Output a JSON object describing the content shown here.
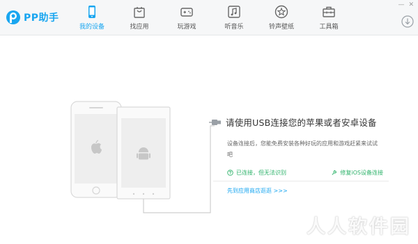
{
  "app": {
    "name": "PP助手",
    "brand_color": "#19a6f0",
    "accent_green": "#2fb36b"
  },
  "nav": {
    "items": [
      {
        "label": "我的设备",
        "icon": "phone-icon",
        "active": true
      },
      {
        "label": "找应用",
        "icon": "shopping-bag-icon",
        "active": false
      },
      {
        "label": "玩游戏",
        "icon": "gamepad-icon",
        "active": false
      },
      {
        "label": "听音乐",
        "icon": "music-icon",
        "active": false
      },
      {
        "label": "铃声壁纸",
        "icon": "star-icon",
        "active": false
      },
      {
        "label": "工具箱",
        "icon": "toolbox-icon",
        "active": false
      }
    ]
  },
  "window_controls": {
    "minimize": "—",
    "close": "✕"
  },
  "main": {
    "headline": "请使用USB连接您的苹果或者安卓设备",
    "description": "设备连接后，您能免费安装各种好玩的应用和游戏赶紧来试试吧",
    "link_recognize": "已连接，但无法识别",
    "link_repair": "修复iOS设备连接",
    "skip_link": "先到应用商店逛逛 >>>"
  },
  "watermark": "人人软件园"
}
